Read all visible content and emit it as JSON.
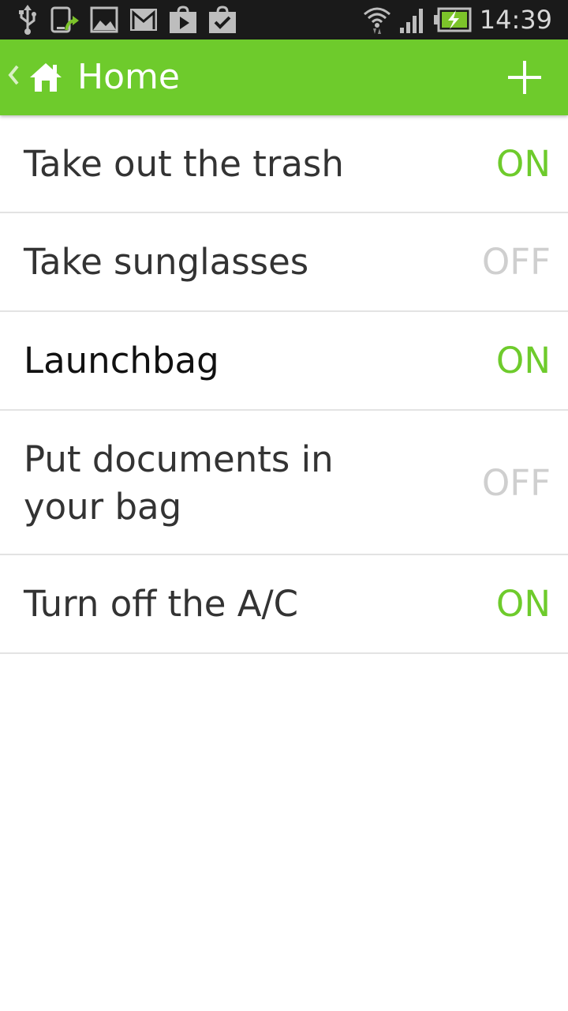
{
  "status_bar": {
    "time": "14:39",
    "icons_left": [
      "usb-icon",
      "sync-icon",
      "gallery-icon",
      "gmail-icon",
      "play-store-icon",
      "shopping-bag-icon"
    ],
    "icons_right": [
      "wifi-icon",
      "signal-icon",
      "battery-charging-icon"
    ]
  },
  "action_bar": {
    "title": "Home",
    "background": "#6ecb2c",
    "icons": [
      "chevron-left-icon",
      "home-icon",
      "plus-icon"
    ]
  },
  "list": {
    "items": [
      {
        "label": "Take out the trash",
        "state": "ON"
      },
      {
        "label": "Take sunglasses",
        "state": "OFF"
      },
      {
        "label": "Launchbag",
        "state": "ON"
      },
      {
        "label": "Put documents in your bag",
        "state": "OFF"
      },
      {
        "label": "Turn off the A/C",
        "state": "ON"
      }
    ]
  },
  "colors": {
    "on": "#6ecb2c",
    "off": "#cfcfcf",
    "divider": "#e3e3e3"
  }
}
